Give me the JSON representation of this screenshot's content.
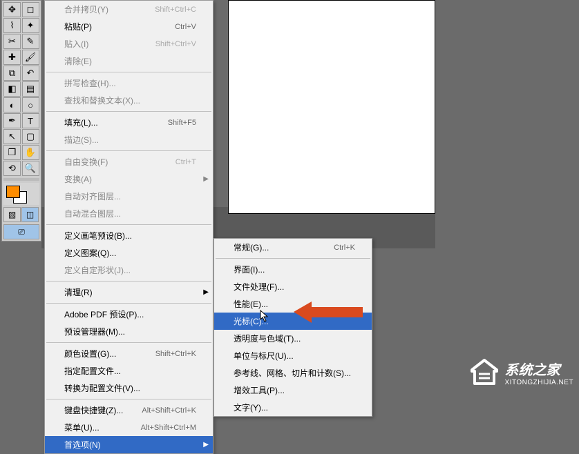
{
  "tools": [
    {
      "name": "move-tool",
      "glyph": "✥"
    },
    {
      "name": "marquee-tool",
      "glyph": "◻"
    },
    {
      "name": "lasso-tool",
      "glyph": "⌇"
    },
    {
      "name": "wand-tool",
      "glyph": "✦"
    },
    {
      "name": "crop-tool",
      "glyph": "✂"
    },
    {
      "name": "eyedropper-tool",
      "glyph": "✎"
    },
    {
      "name": "healing-tool",
      "glyph": "✚"
    },
    {
      "name": "brush-tool",
      "glyph": "🖌"
    },
    {
      "name": "stamp-tool",
      "glyph": "⧉"
    },
    {
      "name": "history-tool",
      "glyph": "↶"
    },
    {
      "name": "eraser-tool",
      "glyph": "◧"
    },
    {
      "name": "gradient-tool",
      "glyph": "▤"
    },
    {
      "name": "blur-tool",
      "glyph": "◐"
    },
    {
      "name": "dodge-tool",
      "glyph": "○"
    },
    {
      "name": "pen-tool",
      "glyph": "✒"
    },
    {
      "name": "type-tool",
      "glyph": "T"
    },
    {
      "name": "path-tool",
      "glyph": "↖"
    },
    {
      "name": "shape-tool",
      "glyph": "▢"
    },
    {
      "name": "3d-tool",
      "glyph": "❒"
    },
    {
      "name": "hand-tool",
      "glyph": "✋"
    },
    {
      "name": "rotate-tool",
      "glyph": "⟲"
    },
    {
      "name": "zoom-tool",
      "glyph": "🔍"
    }
  ],
  "menu": {
    "items": [
      {
        "label": "合并拷贝(Y)",
        "shortcut": "Shift+Ctrl+C",
        "disabled": true
      },
      {
        "label": "粘贴(P)",
        "shortcut": "Ctrl+V"
      },
      {
        "label": "贴入(I)",
        "shortcut": "Shift+Ctrl+V",
        "disabled": true
      },
      {
        "label": "清除(E)",
        "disabled": true
      },
      {
        "sep": true
      },
      {
        "label": "拼写检查(H)...",
        "disabled": true
      },
      {
        "label": "查找和替换文本(X)...",
        "disabled": true
      },
      {
        "sep": true
      },
      {
        "label": "填充(L)...",
        "shortcut": "Shift+F5"
      },
      {
        "label": "描边(S)...",
        "disabled": true
      },
      {
        "sep": true
      },
      {
        "label": "自由变换(F)",
        "shortcut": "Ctrl+T",
        "disabled": true
      },
      {
        "label": "变换(A)",
        "disabled": true,
        "arrow": true
      },
      {
        "label": "自动对齐图层...",
        "disabled": true
      },
      {
        "label": "自动混合图层...",
        "disabled": true
      },
      {
        "sep": true
      },
      {
        "label": "定义画笔预设(B)..."
      },
      {
        "label": "定义图案(Q)..."
      },
      {
        "label": "定义自定形状(J)...",
        "disabled": true
      },
      {
        "sep": true
      },
      {
        "label": "清理(R)",
        "arrow": true
      },
      {
        "sep": true
      },
      {
        "label": "Adobe PDF 预设(P)..."
      },
      {
        "label": "预设管理器(M)..."
      },
      {
        "sep": true
      },
      {
        "label": "颜色设置(G)...",
        "shortcut": "Shift+Ctrl+K"
      },
      {
        "label": "指定配置文件..."
      },
      {
        "label": "转换为配置文件(V)..."
      },
      {
        "sep": true
      },
      {
        "label": "键盘快捷键(Z)...",
        "shortcut": "Alt+Shift+Ctrl+K"
      },
      {
        "label": "菜单(U)...",
        "shortcut": "Alt+Shift+Ctrl+M"
      },
      {
        "label": "首选项(N)",
        "arrow": true,
        "highlight": true
      }
    ]
  },
  "submenu": {
    "items": [
      {
        "label": "常规(G)...",
        "shortcut": "Ctrl+K"
      },
      {
        "sep": true
      },
      {
        "label": "界面(I)..."
      },
      {
        "label": "文件处理(F)..."
      },
      {
        "label": "性能(E)..."
      },
      {
        "label": "光标(C)...",
        "highlight": true
      },
      {
        "label": "透明度与色域(T)..."
      },
      {
        "label": "单位与标尺(U)..."
      },
      {
        "label": "参考线、网格、切片和计数(S)..."
      },
      {
        "label": "增效工具(P)..."
      },
      {
        "label": "文字(Y)..."
      }
    ]
  },
  "watermark": {
    "cn": "系统之家",
    "en": "XITONGZHIJIA.NET"
  }
}
